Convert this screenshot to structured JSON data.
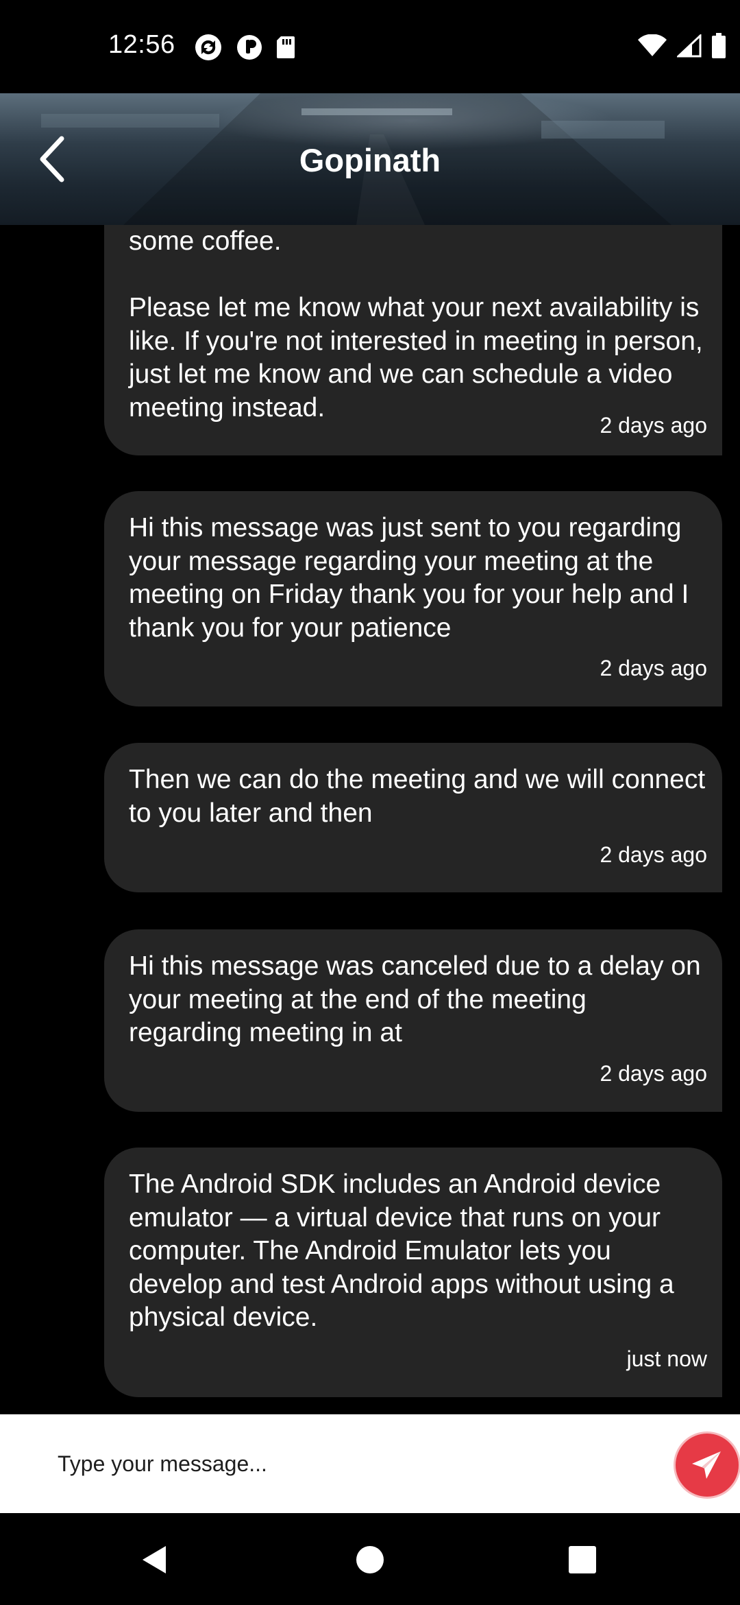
{
  "status_bar": {
    "time": "12:56",
    "left_icons": [
      "sync-icon",
      "data-saver-icon",
      "sd-card-icon"
    ],
    "right_icons": [
      "wifi-icon",
      "signal-icon",
      "battery-icon"
    ]
  },
  "header": {
    "title": "Gopinath",
    "back_icon": "chevron-left-icon"
  },
  "messages": [
    {
      "text": "some coffee.\n\nPlease let me know what your next availability is like. If you're not interested in meeting in person, just let me know and we can schedule a video meeting instead.",
      "time": "2 days ago"
    },
    {
      "text": "Hi this message was just sent to you regarding your message regarding your meeting at the meeting on Friday thank you for your help and I thank you for your patience",
      "time": "2 days ago"
    },
    {
      "text": "Then we can do the meeting and we will connect to you later and then",
      "time": "2 days ago"
    },
    {
      "text": "Hi this message was canceled due to a delay on your meeting at the end of the meeting regarding meeting in at",
      "time": "2 days ago"
    },
    {
      "text": "The Android SDK includes an Android device emulator — a virtual device that runs on your computer. The Android Emulator lets you develop and test Android apps without using a physical device.",
      "time": "just now"
    }
  ],
  "composer": {
    "placeholder": "Type your message...",
    "value": "",
    "send_icon": "send-icon"
  },
  "nav_bar": {
    "back_icon": "nav-back-icon",
    "home_icon": "nav-home-icon",
    "recents_icon": "nav-recents-icon"
  },
  "colors": {
    "background": "#000000",
    "bubble": "#252525",
    "send_button": "#e63a46",
    "composer_bg": "#ffffff"
  }
}
